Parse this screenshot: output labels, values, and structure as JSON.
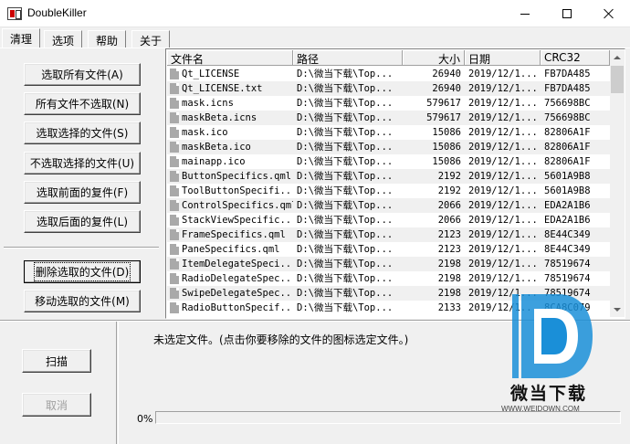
{
  "window": {
    "title": "DoubleKiller"
  },
  "tabs": [
    {
      "label": "清理"
    },
    {
      "label": "选项"
    },
    {
      "label": "帮助"
    },
    {
      "label": "关于"
    }
  ],
  "actions": {
    "select_all": "选取所有文件(A)",
    "deselect_all": "所有文件不选取(N)",
    "select_selected": "选取选择的文件(S)",
    "deselect_selected": "不选取选择的文件(U)",
    "select_first_dup": "选取前面的复件(F)",
    "select_last_dup": "选取后面的复件(L)",
    "delete_selected": "删除选取的文件(D)",
    "move_selected": "移动选取的文件(M)"
  },
  "list": {
    "columns": {
      "name": "文件名",
      "path": "路径",
      "size": "大小",
      "date": "日期",
      "crc": "CRC32"
    },
    "rows": [
      {
        "name": "Qt_LICENSE",
        "path": "D:\\微当下载\\Top...",
        "size": "26940",
        "date": "2019/12/1...",
        "crc": "FB7DA485"
      },
      {
        "name": "Qt_LICENSE.txt",
        "path": "D:\\微当下载\\Top...",
        "size": "26940",
        "date": "2019/12/1...",
        "crc": "FB7DA485"
      },
      {
        "name": "mask.icns",
        "path": "D:\\微当下载\\Top...",
        "size": "579617",
        "date": "2019/12/1...",
        "crc": "756698BC"
      },
      {
        "name": "maskBeta.icns",
        "path": "D:\\微当下载\\Top...",
        "size": "579617",
        "date": "2019/12/1...",
        "crc": "756698BC"
      },
      {
        "name": "mask.ico",
        "path": "D:\\微当下载\\Top...",
        "size": "15086",
        "date": "2019/12/1...",
        "crc": "82806A1F"
      },
      {
        "name": "maskBeta.ico",
        "path": "D:\\微当下载\\Top...",
        "size": "15086",
        "date": "2019/12/1...",
        "crc": "82806A1F"
      },
      {
        "name": "mainapp.ico",
        "path": "D:\\微当下载\\Top...",
        "size": "15086",
        "date": "2019/12/1...",
        "crc": "82806A1F"
      },
      {
        "name": "ButtonSpecifics.qml",
        "path": "D:\\微当下载\\Top...",
        "size": "2192",
        "date": "2019/12/1...",
        "crc": "5601A9B8"
      },
      {
        "name": "ToolButtonSpecifi...",
        "path": "D:\\微当下载\\Top...",
        "size": "2192",
        "date": "2019/12/1...",
        "crc": "5601A9B8"
      },
      {
        "name": "ControlSpecifics.qml",
        "path": "D:\\微当下载\\Top...",
        "size": "2066",
        "date": "2019/12/1...",
        "crc": "EDA2A1B6"
      },
      {
        "name": "StackViewSpecific...",
        "path": "D:\\微当下载\\Top...",
        "size": "2066",
        "date": "2019/12/1...",
        "crc": "EDA2A1B6"
      },
      {
        "name": "FrameSpecifics.qml",
        "path": "D:\\微当下载\\Top...",
        "size": "2123",
        "date": "2019/12/1...",
        "crc": "8E44C349"
      },
      {
        "name": "PaneSpecifics.qml",
        "path": "D:\\微当下载\\Top...",
        "size": "2123",
        "date": "2019/12/1...",
        "crc": "8E44C349"
      },
      {
        "name": "ItemDelegateSpeci...",
        "path": "D:\\微当下载\\Top...",
        "size": "2198",
        "date": "2019/12/1...",
        "crc": "78519674"
      },
      {
        "name": "RadioDelegateSpec...",
        "path": "D:\\微当下载\\Top...",
        "size": "2198",
        "date": "2019/12/1...",
        "crc": "78519674"
      },
      {
        "name": "SwipeDelegateSpec...",
        "path": "D:\\微当下载\\Top...",
        "size": "2198",
        "date": "2019/12/1...",
        "crc": "78519674"
      },
      {
        "name": "RadioButtonSpecif...",
        "path": "D:\\微当下载\\Top...",
        "size": "2133",
        "date": "2019/12/1...",
        "crc": "8CA8C079"
      }
    ]
  },
  "bottom": {
    "scan_label": "扫描",
    "cancel_label": "取消",
    "status": "未选定文件。(点击你要移除的文件的图标选定文件。)",
    "progress_text": "0%",
    "progress_value": 0
  },
  "watermark": {
    "brand": "微当下载",
    "url": "WWW.WEIDOWN.COM"
  },
  "colors": {
    "accent": "#0078d7",
    "watermark_blue": "#1a8fd8"
  },
  "icons": [
    "app-icon",
    "minimize-icon",
    "maximize-icon",
    "close-icon",
    "file-icon",
    "scroll-up-icon",
    "scroll-down-icon"
  ]
}
